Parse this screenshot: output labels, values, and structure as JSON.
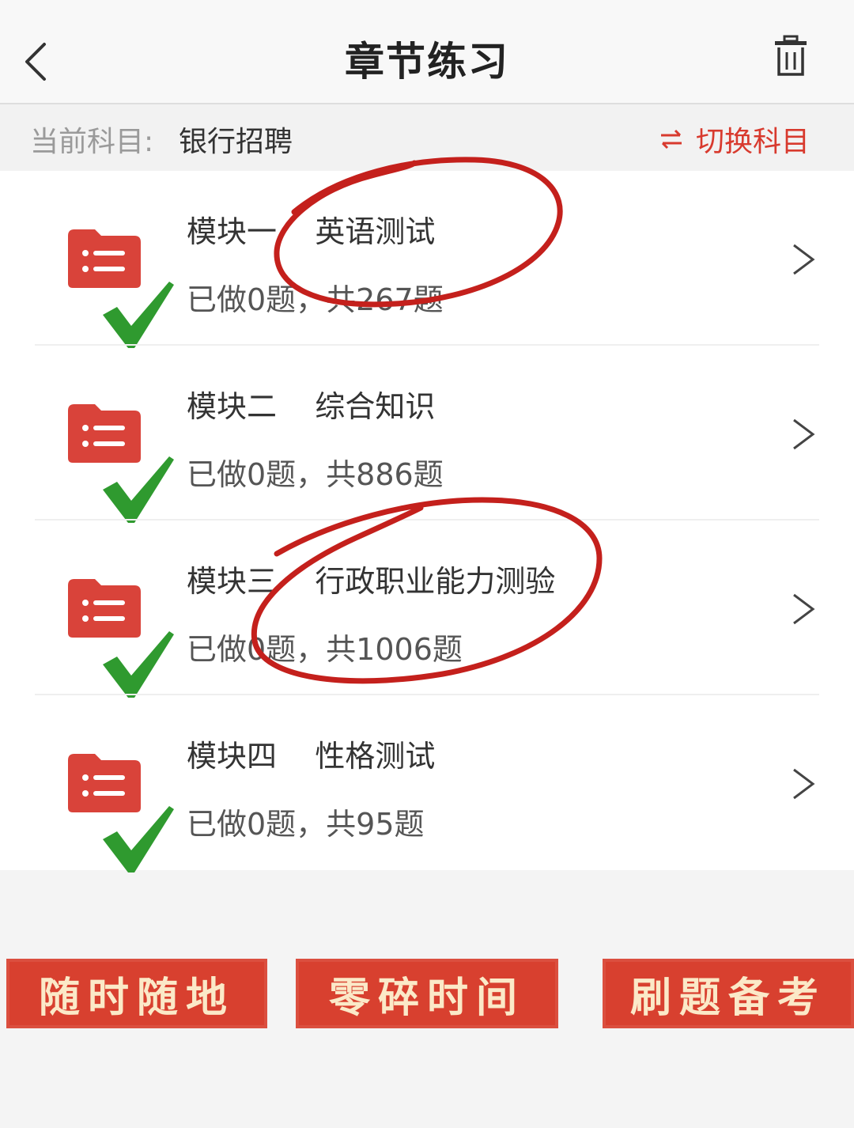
{
  "navbar": {
    "title": "章节练习",
    "back_icon": "chevron-left-icon",
    "trash_icon": "trash-icon"
  },
  "subject": {
    "label": "当前科目:",
    "value": "银行招聘",
    "switch_label": "切换科目",
    "switch_icon": "swap-arrows-icon"
  },
  "modules": [
    {
      "title": "模块一    英语测试",
      "progress": "已做0题，共267题"
    },
    {
      "title": "模块二    综合知识",
      "progress": "已做0题，共886题"
    },
    {
      "title": "模块三    行政职业能力测验",
      "progress": "已做0题，共1006题"
    },
    {
      "title": "模块四    性格测试",
      "progress": "已做0题，共95题"
    }
  ],
  "slogans": [
    "随时随地",
    "零碎时间",
    "刷题备考"
  ],
  "colors": {
    "accent": "#d83a2e",
    "folder": "#d9433a",
    "check": "#2f9a2f",
    "annotation": "#c4201c",
    "slogan_text": "#fbe9c8"
  }
}
